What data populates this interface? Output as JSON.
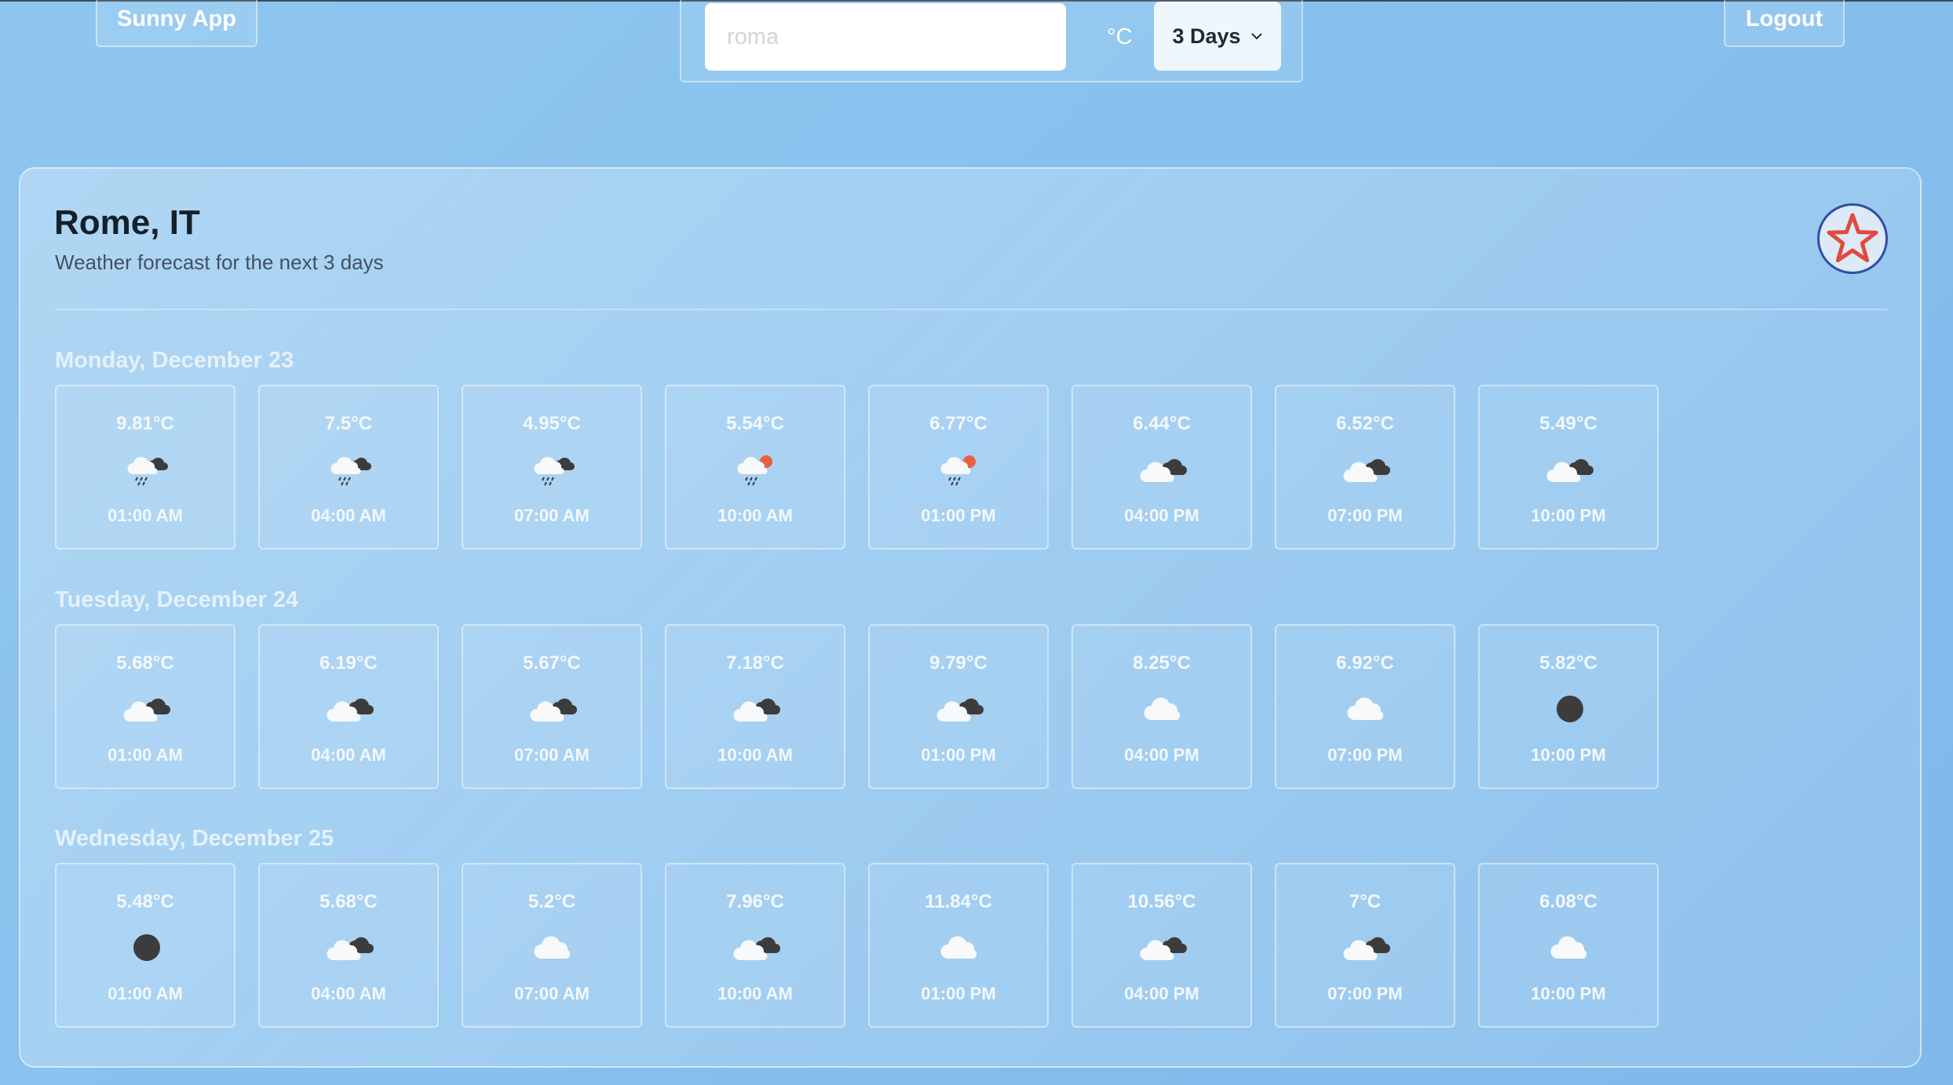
{
  "brand": "Sunny App",
  "logout_label": "Logout",
  "search": {
    "placeholder": "roma",
    "value": ""
  },
  "unit": "°C",
  "range_label": "3 Days",
  "location": {
    "city": "Rome, IT",
    "subtitle": "Weather forecast for the next 3 days"
  },
  "days": [
    {
      "title": "Monday, December 23",
      "slots": [
        {
          "temp": "9.81°C",
          "time": "01:00 AM",
          "icon": "rain-night-icon"
        },
        {
          "temp": "7.5°C",
          "time": "04:00 AM",
          "icon": "rain-night-icon"
        },
        {
          "temp": "4.95°C",
          "time": "07:00 AM",
          "icon": "rain-night-icon"
        },
        {
          "temp": "5.54°C",
          "time": "10:00 AM",
          "icon": "rain-sun-icon"
        },
        {
          "temp": "6.77°C",
          "time": "01:00 PM",
          "icon": "rain-sun-icon"
        },
        {
          "temp": "6.44°C",
          "time": "04:00 PM",
          "icon": "broken-clouds-icon"
        },
        {
          "temp": "6.52°C",
          "time": "07:00 PM",
          "icon": "broken-clouds-icon"
        },
        {
          "temp": "5.49°C",
          "time": "10:00 PM",
          "icon": "broken-clouds-icon"
        }
      ]
    },
    {
      "title": "Tuesday, December 24",
      "slots": [
        {
          "temp": "5.68°C",
          "time": "01:00 AM",
          "icon": "broken-clouds-icon"
        },
        {
          "temp": "6.19°C",
          "time": "04:00 AM",
          "icon": "broken-clouds-icon"
        },
        {
          "temp": "5.67°C",
          "time": "07:00 AM",
          "icon": "broken-clouds-icon"
        },
        {
          "temp": "7.18°C",
          "time": "10:00 AM",
          "icon": "broken-clouds-icon"
        },
        {
          "temp": "9.79°C",
          "time": "01:00 PM",
          "icon": "broken-clouds-icon"
        },
        {
          "temp": "8.25°C",
          "time": "04:00 PM",
          "icon": "cloud-icon"
        },
        {
          "temp": "6.92°C",
          "time": "07:00 PM",
          "icon": "cloud-icon"
        },
        {
          "temp": "5.82°C",
          "time": "10:00 PM",
          "icon": "clear-night-icon"
        }
      ]
    },
    {
      "title": "Wednesday, December 25",
      "slots": [
        {
          "temp": "5.48°C",
          "time": "01:00 AM",
          "icon": "clear-night-icon"
        },
        {
          "temp": "5.68°C",
          "time": "04:00 AM",
          "icon": "broken-clouds-icon"
        },
        {
          "temp": "5.2°C",
          "time": "07:00 AM",
          "icon": "cloud-icon"
        },
        {
          "temp": "7.96°C",
          "time": "10:00 AM",
          "icon": "broken-clouds-icon"
        },
        {
          "temp": "11.84°C",
          "time": "01:00 PM",
          "icon": "cloud-icon"
        },
        {
          "temp": "10.56°C",
          "time": "04:00 PM",
          "icon": "broken-clouds-icon"
        },
        {
          "temp": "7°C",
          "time": "07:00 PM",
          "icon": "broken-clouds-icon"
        },
        {
          "temp": "6.08°C",
          "time": "10:00 PM",
          "icon": "cloud-icon"
        }
      ]
    }
  ],
  "colors": {
    "accent": "#2f4fa3",
    "star": "#e04a3c",
    "background": "#8fc6ef"
  }
}
